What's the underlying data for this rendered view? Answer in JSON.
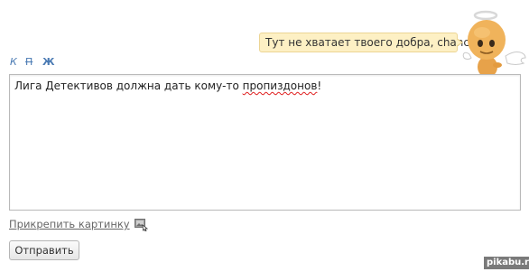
{
  "bubble": {
    "text": "Тут не хватает твоего добра, chance"
  },
  "mascot": {
    "icon": "angel-mascot-icon"
  },
  "toolbar": {
    "italic_label": "К",
    "strike_label": "П",
    "bold_label": "Ж"
  },
  "editor": {
    "text_before": "Лига Детективов должна дать кому-то ",
    "text_misspelled": "пропиздонов",
    "text_after": "!"
  },
  "attach": {
    "label": "Прикрепить картинку",
    "icon": "picture-icon"
  },
  "send": {
    "label": "Отправить"
  },
  "watermark": {
    "text": "pikabu.ru"
  }
}
